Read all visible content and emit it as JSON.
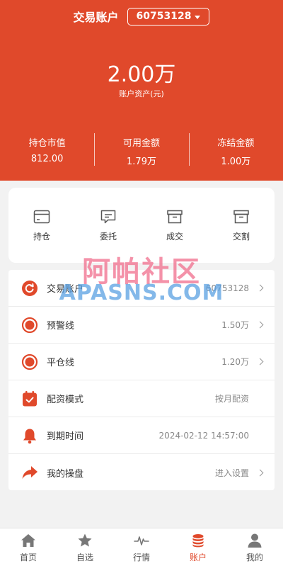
{
  "header": {
    "title": "交易账户",
    "account_number": "60753128",
    "total_assets": "2.00万",
    "total_assets_label": "账户资产(元)",
    "stats": [
      {
        "label": "持仓市值",
        "value": "812.00"
      },
      {
        "label": "可用金额",
        "value": "1.79万"
      },
      {
        "label": "冻结金额",
        "value": "1.00万"
      }
    ]
  },
  "quick_actions": [
    {
      "label": "持仓",
      "icon": "position-card-icon"
    },
    {
      "label": "委托",
      "icon": "order-message-icon"
    },
    {
      "label": "成交",
      "icon": "deal-box-icon"
    },
    {
      "label": "交割",
      "icon": "settlement-box-icon"
    }
  ],
  "list": [
    {
      "label": "交易账户",
      "value": "60753128",
      "icon": "refresh-circle-icon"
    },
    {
      "label": "预警线",
      "value": "1.50万",
      "icon": "warning-ring-icon"
    },
    {
      "label": "平仓线",
      "value": "1.20万",
      "icon": "close-ring-icon"
    },
    {
      "label": "配资模式",
      "value": "按月配资",
      "icon": "calendar-check-icon"
    },
    {
      "label": "到期时间",
      "value": "2024-02-12 14:57:00",
      "icon": "bell-icon"
    },
    {
      "label": "我的操盘",
      "value": "进入设置",
      "icon": "share-arrow-icon"
    }
  ],
  "watermark": {
    "cn": "阿帕社区",
    "en": "APASNS.COM"
  },
  "tabbar": [
    {
      "label": "首页",
      "icon": "home-icon"
    },
    {
      "label": "自选",
      "icon": "star-icon"
    },
    {
      "label": "行情",
      "icon": "pulse-icon"
    },
    {
      "label": "账户",
      "icon": "coins-stack-icon"
    },
    {
      "label": "我的",
      "icon": "user-icon"
    }
  ],
  "colors": {
    "accent": "#e0492b",
    "background": "#f2f2f2",
    "tab_inactive": "#777777"
  }
}
